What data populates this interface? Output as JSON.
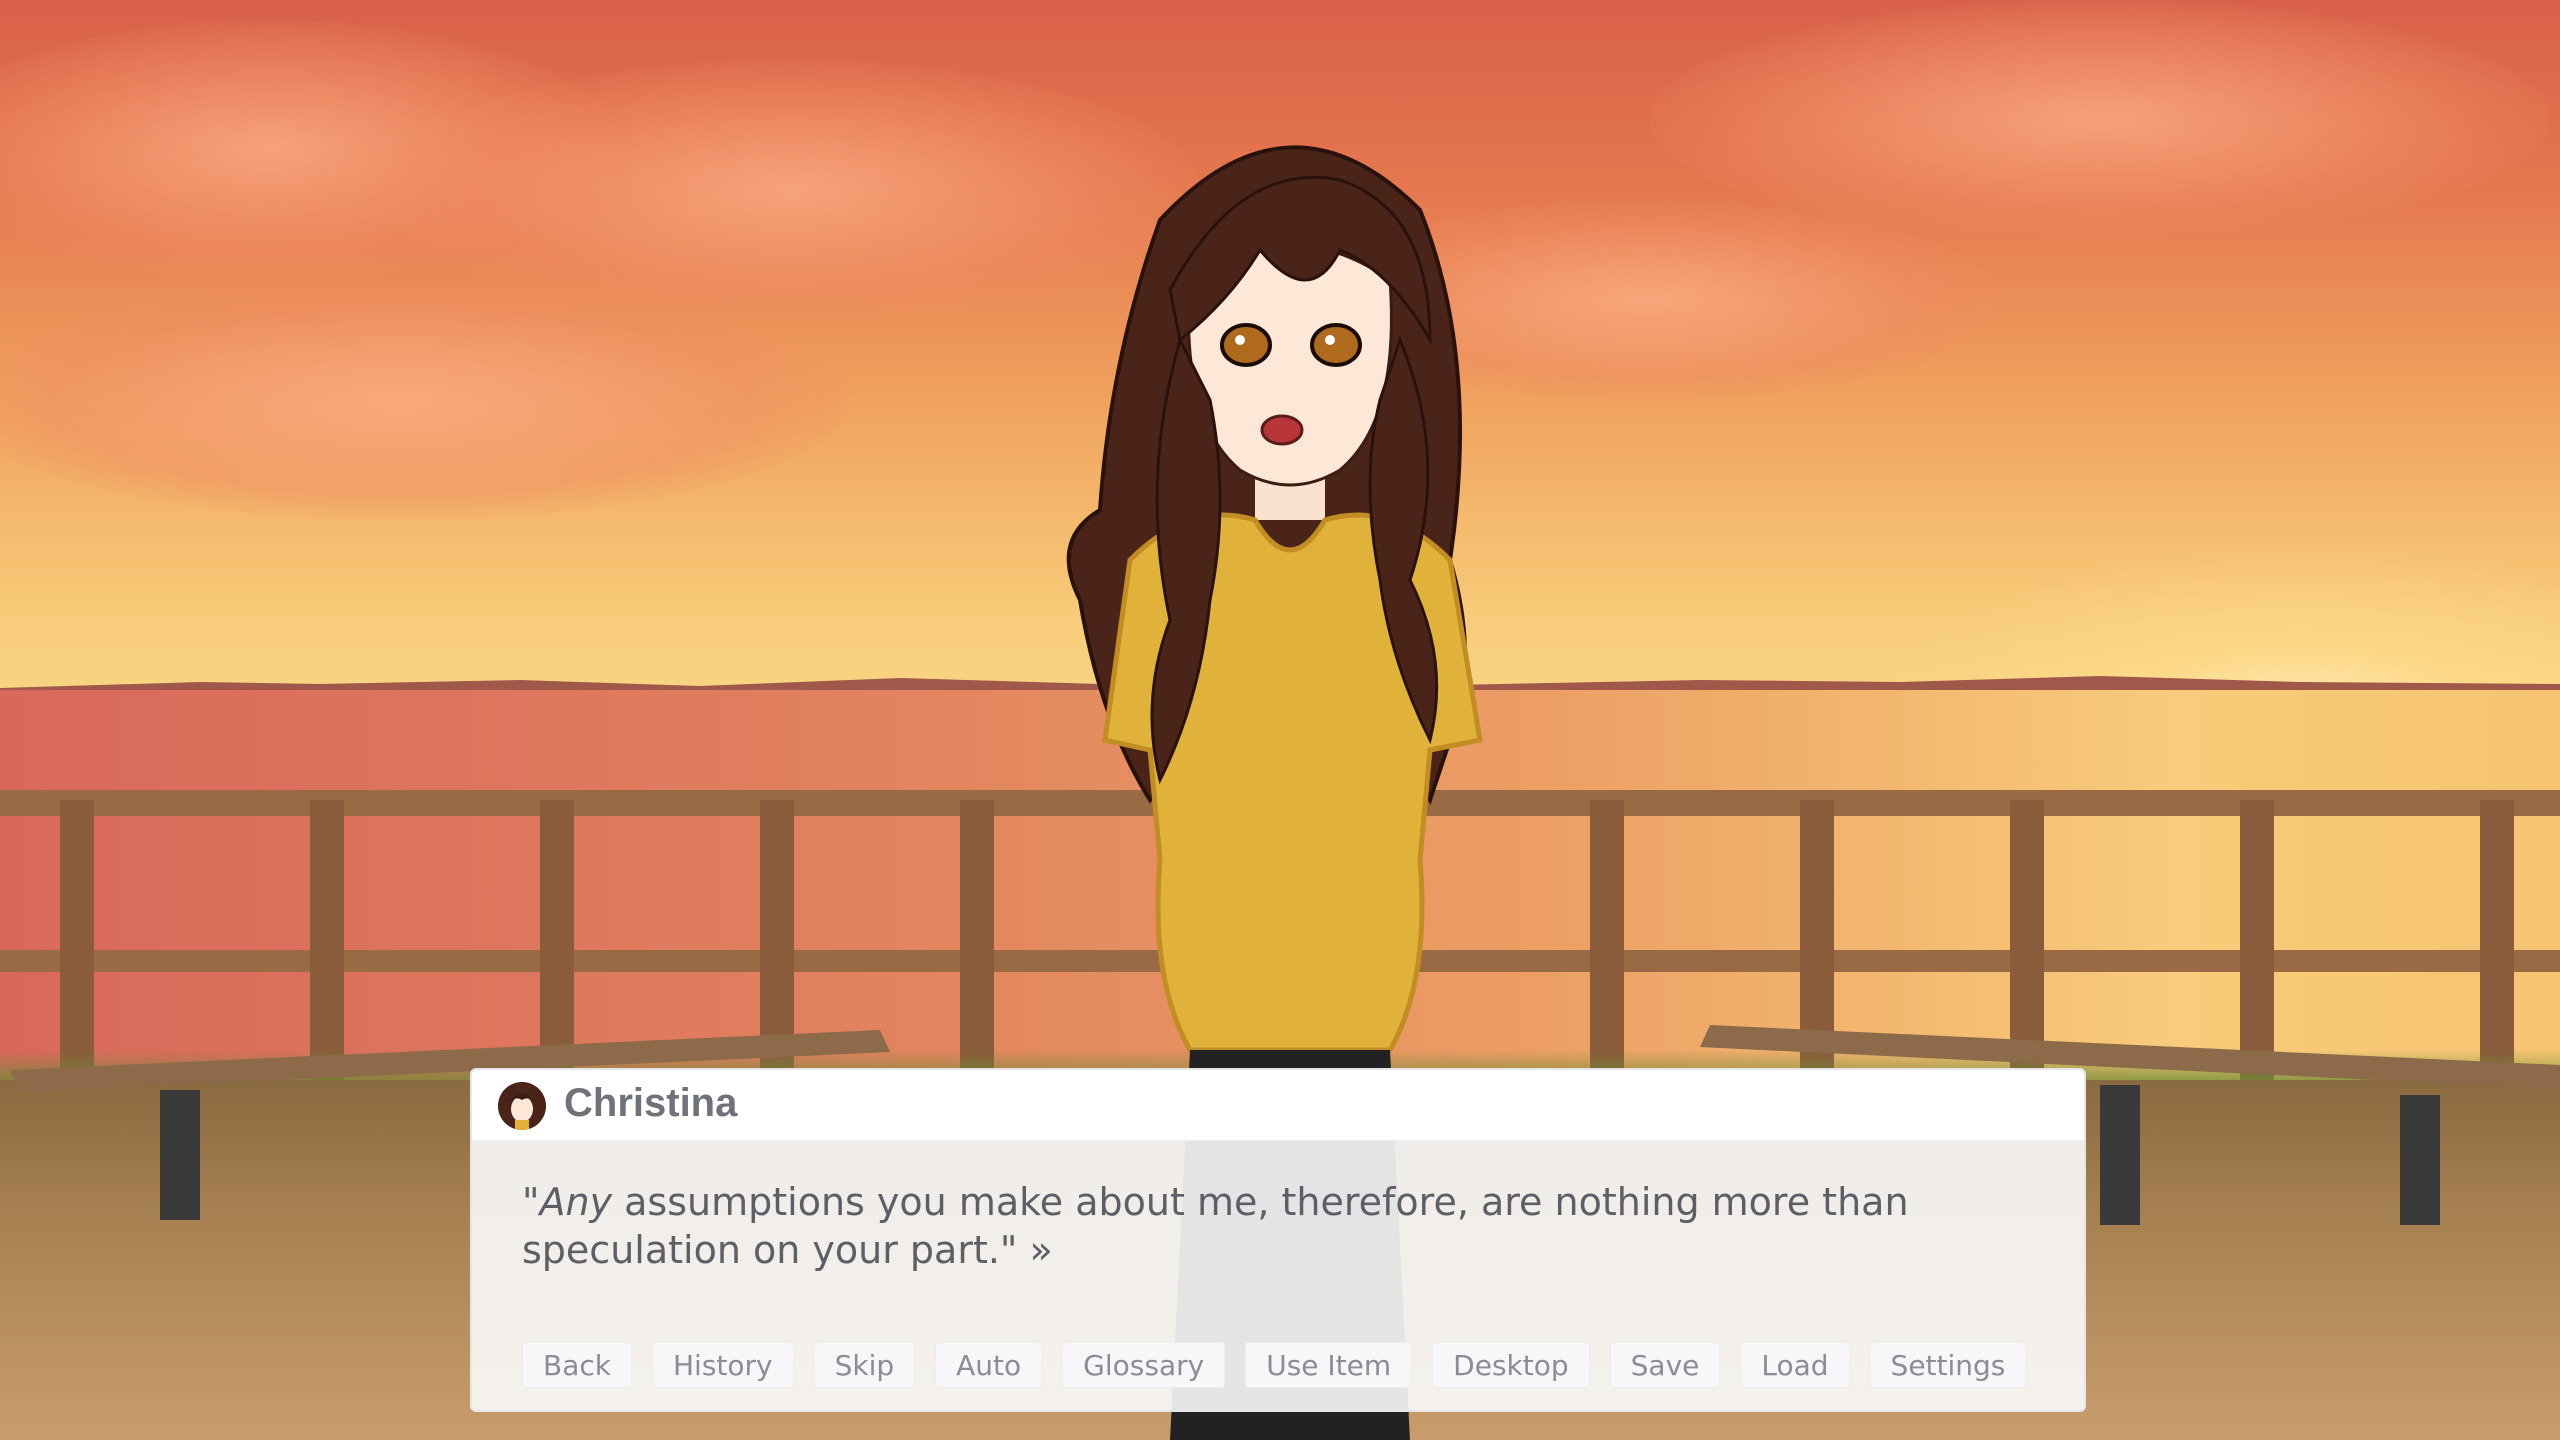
{
  "dialogue": {
    "speaker": "Christina",
    "open_quote": "\"",
    "emphasis": "Any",
    "text_rest": " assumptions you make about me, therefore, are nothing more than speculation on your part.\"",
    "continue_glyph": "»"
  },
  "quick_menu": [
    {
      "label": "Back"
    },
    {
      "label": "History"
    },
    {
      "label": "Skip"
    },
    {
      "label": "Auto"
    },
    {
      "label": "Glossary"
    },
    {
      "label": "Use Item"
    },
    {
      "label": "Desktop"
    },
    {
      "label": "Save"
    },
    {
      "label": "Load"
    },
    {
      "label": "Settings"
    }
  ],
  "colors": {
    "sky": "#e5794f",
    "sea": "#ec9e64",
    "shirt": "#e0b23a",
    "hair": "#4a2418",
    "textbox": "#fafafb"
  }
}
